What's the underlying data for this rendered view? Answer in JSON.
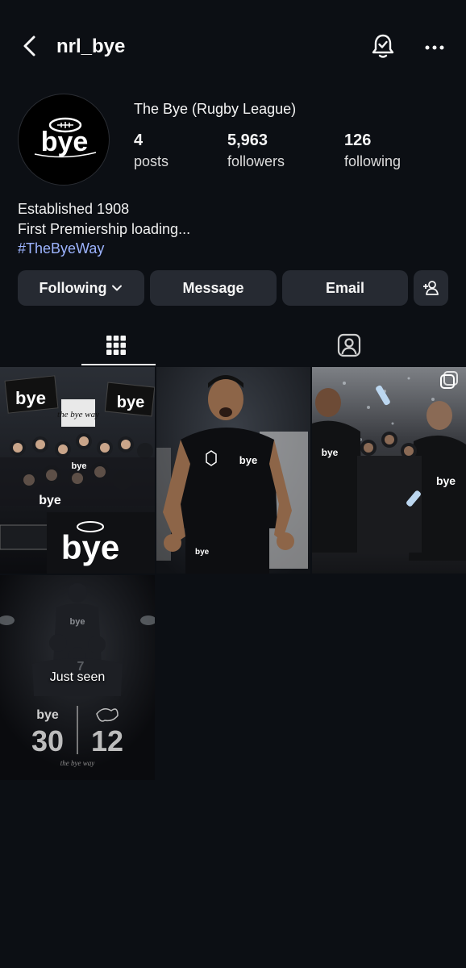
{
  "header": {
    "username": "nrl_bye",
    "back_icon": "chevron-left-icon",
    "notify_icon": "bell-check-icon",
    "more_icon": "more-horizontal-icon"
  },
  "profile": {
    "display_name": "The Bye (Rugby League)",
    "avatar_text": "bye",
    "stats": [
      {
        "value": "4",
        "label": "posts"
      },
      {
        "value": "5,963",
        "label": "followers"
      },
      {
        "value": "126",
        "label": "following"
      }
    ],
    "bio": {
      "line1": "Established 1908",
      "line2": "First Premiership loading...",
      "hashtag": "#TheByeWay"
    }
  },
  "actions": {
    "following_label": "Following",
    "message_label": "Message",
    "email_label": "Email",
    "add_person_icon": "add-person-icon"
  },
  "tabs": [
    {
      "name": "grid-icon",
      "active": true
    },
    {
      "name": "tagged-icon",
      "active": false
    }
  ],
  "posts": {
    "post1_sign_text": "the bye way",
    "post1_banner_text": "bye",
    "post4_overlay": "Just seen",
    "post4_score_left": "30",
    "post4_score_right": "12",
    "post4_logo": "bye",
    "post4_tagline": "the bye way"
  },
  "colors": {
    "background": "#0c0f14",
    "button": "#262a32",
    "hashtag": "#9db4ff"
  }
}
